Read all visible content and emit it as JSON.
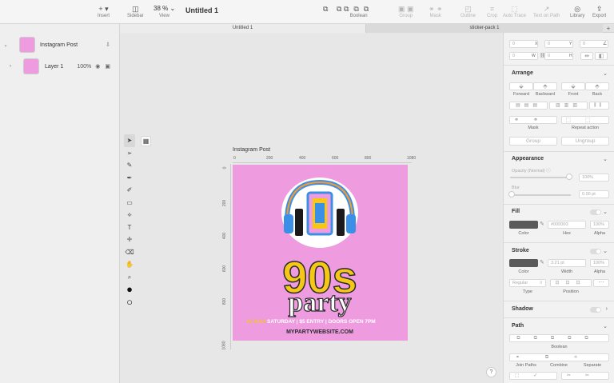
{
  "toolbar": {
    "insert_label": "Insert",
    "sidebar_label": "Sidebar",
    "view_label": "View",
    "zoom_value": "38 %",
    "document_title": "Untitled 1",
    "boolean_label": "Boolean",
    "group_label": "Group",
    "mask_label": "Mask",
    "outline_label": "Outline",
    "crop_label": "Crop",
    "autotrace_label": "Auto Trace",
    "textonpath_label": "Text on Path",
    "library_label": "Library",
    "export_label": "Export"
  },
  "tabs": [
    "Untitled 1",
    "sticker-pack 1"
  ],
  "layers": [
    {
      "name": "Instagram Post"
    },
    {
      "name": "Layer 1",
      "opacity": "100%"
    }
  ],
  "artboard": {
    "label": "Instagram Post",
    "ruler_h": [
      "0",
      "200",
      "400",
      "600",
      "800",
      "1080"
    ],
    "ruler_v": [
      "0",
      "200",
      "400",
      "600",
      "800",
      "1080"
    ],
    "poster": {
      "headline_top": "90s",
      "headline_bottom": "party",
      "date": "22 JULY",
      "info": "SATURDAY | $5 ENTRY | DOORS OPEN 7PM",
      "website": "MYPARTYWEBSITE.COM",
      "colors": {
        "bg": "#ee9be0",
        "yellow": "#f5c818",
        "blue": "#3b8fe6",
        "orange": "#f79a2a"
      }
    }
  },
  "inspector": {
    "x_value": "0",
    "x_label": "X",
    "y_value": "0",
    "y_label": "Y",
    "r_value": "0",
    "w_value": "0",
    "w_label": "W",
    "h_value": "0",
    "h_label": "H",
    "arrange_title": "Arrange",
    "forward": "Forward",
    "backward": "Backward",
    "front": "Front",
    "back": "Back",
    "mask": "Mask",
    "repeat_action": "Repeat action",
    "group": "Group",
    "ungroup": "Ungroup",
    "appearance_title": "Appearance",
    "opacity_label": "Opacity (Normal)",
    "opacity_value": "100%",
    "blur_label": "Blur",
    "blur_value": "0.00 pt",
    "fill_title": "Fill",
    "fill_hex": "#000000",
    "fill_alpha": "100%",
    "color_label": "Color",
    "hex_label": "Hex",
    "alpha_label": "Alpha",
    "stroke_title": "Stroke",
    "stroke_width": "3.21 pt",
    "stroke_alpha": "100%",
    "width_label": "Width",
    "type_value": "Regular",
    "type_label": "Type",
    "position_label": "Position",
    "shadow_title": "Shadow",
    "path_title": "Path",
    "boolean_label": "Boolean",
    "join_paths": "Join Paths",
    "combine": "Combine",
    "separate": "Separate"
  },
  "help": "?"
}
